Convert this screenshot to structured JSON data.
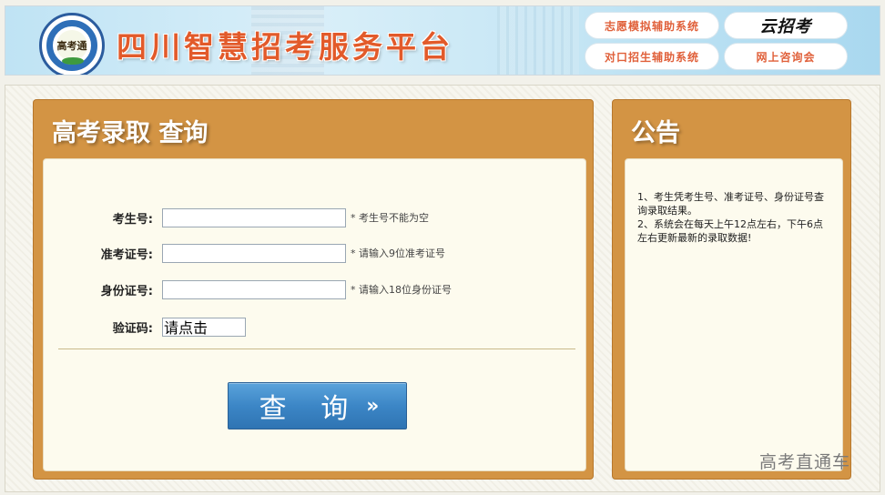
{
  "header": {
    "logo_text": "高考通",
    "site_title": "四川智慧招考服务平台",
    "links": {
      "volunteer_system": "志愿模拟辅助系统",
      "counterpart_system": "对口招生辅助系统",
      "brand": "云招考",
      "online_consult": "网上咨询会"
    }
  },
  "query_panel": {
    "title": "高考录取 查询",
    "fields": {
      "exam_number": {
        "label": "考生号:",
        "value": "",
        "hint": "* 考生号不能为空"
      },
      "admission_ticket": {
        "label": "准考证号:",
        "value": "",
        "hint": "* 请输入9位准考证号"
      },
      "id_card": {
        "label": "身份证号:",
        "value": "",
        "hint": "* 请输入18位身份证号"
      },
      "captcha": {
        "label": "验证码:",
        "text": "请点击"
      }
    },
    "submit_label": "查 询"
  },
  "notice_panel": {
    "title": "公告",
    "items": [
      "1、考生凭考生号、准考证号、身份证号查询录取结果。",
      "2、系统会在每天上午12点左右，下午6点左右更新最新的录取数据!"
    ]
  },
  "watermark": "高考直通车",
  "colors": {
    "panel": "#d39444",
    "panel_inner": "#fdfbee",
    "title_orange": "#e25a2a",
    "button_blue": "#3c86c6"
  }
}
